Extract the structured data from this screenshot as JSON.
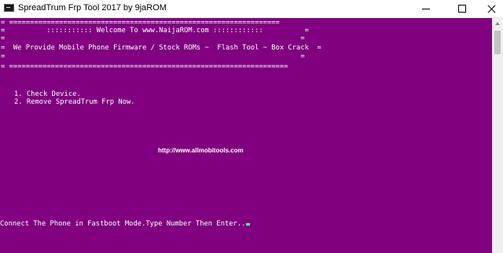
{
  "window": {
    "title": "SpreadTrum Frp Tool 2017 by 9jaROM",
    "icon": "console-icon",
    "controls": {
      "minimize": "minimize-icon",
      "maximize": "maximize-icon",
      "close": "close-icon"
    }
  },
  "colors": {
    "console_background": "#800080",
    "console_text": "#ffffff",
    "cursor": "#55ff88"
  },
  "console": {
    "banner": [
      "= =================================================================",
      "=          ::::::::::: Welcome To www.NaijaROM.com ::::::::::::          =",
      "=                                                                       =",
      "=  We Provide Mobile Phone Firmware / Stock ROMs ~  Flash Tool ~ Box Crack  =",
      "=                                                                       =",
      "= ==================================================================="
    ],
    "menu": [
      "1. Check Device.",
      "2. Remove SpreadTrum Frp Now."
    ],
    "url": "http://www.allmobitools.com",
    "prompt": "Connect The Phone in Fastboot Mode.Type Number Then Enter.."
  }
}
